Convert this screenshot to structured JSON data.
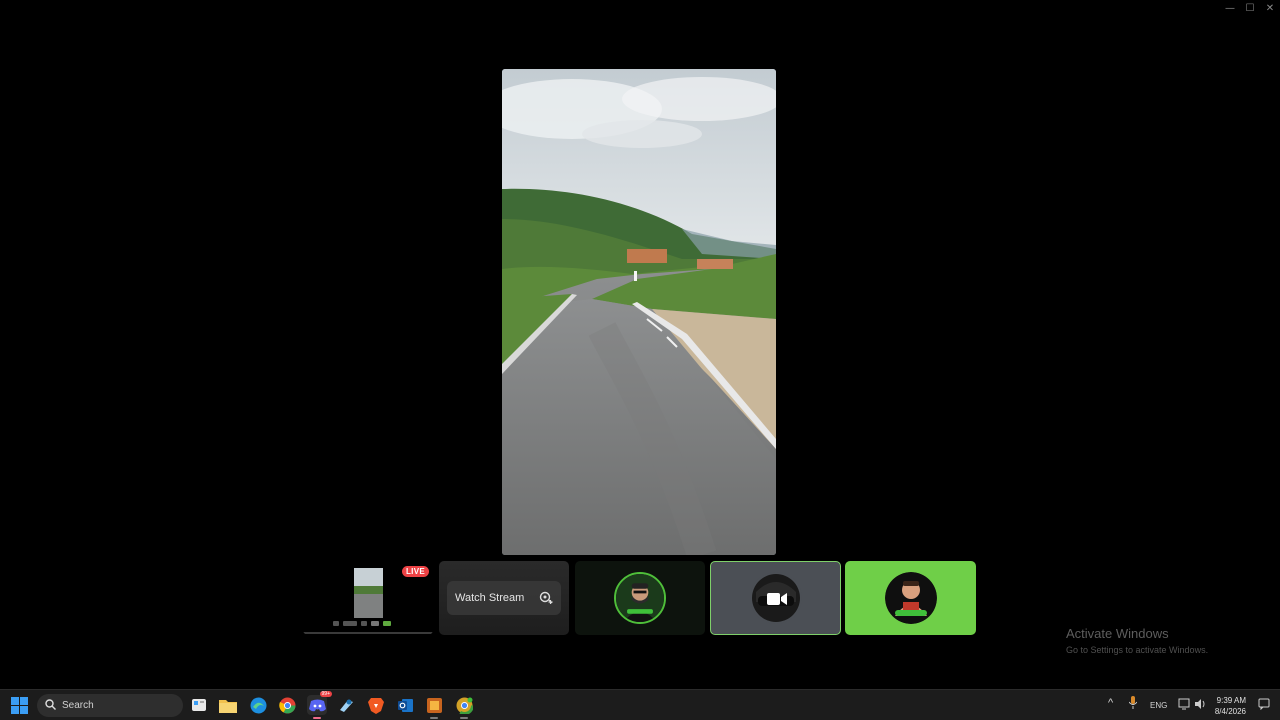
{
  "window": {
    "controls": [
      "minimize-icon",
      "maximize-icon",
      "close-icon"
    ]
  },
  "stream": {
    "content": "road-video-frame"
  },
  "tiles": {
    "self": {
      "live_label": "LIVE"
    },
    "watch": {
      "label": "Watch Stream",
      "icon": "watch-stream-icon"
    },
    "user1": {
      "avatar": "bearded-man-avatar"
    },
    "user2": {
      "state": "camera",
      "icon": "video-camera-icon"
    },
    "user3": {
      "avatar": "cartoon-man-avatar"
    }
  },
  "watermark": {
    "title": "Activate Windows",
    "subtitle": "Go to Settings to activate Windows."
  },
  "taskbar": {
    "search_label": "Search",
    "apps": [
      "start-icon",
      "widgets-icon",
      "file-explorer-icon",
      "edge-icon",
      "chrome-icon",
      "discord-icon",
      "steam-icon",
      "brave-icon",
      "outlook-icon",
      "game-icon",
      "chrome-dev-icon"
    ],
    "tray": {
      "language": "ENG",
      "time": "9:39 AM",
      "date": "8/4/2026"
    },
    "discord_badge": "99+"
  },
  "colors": {
    "accent_green": "#6fcf48",
    "live_red": "#ed4245",
    "background": "#000000"
  }
}
